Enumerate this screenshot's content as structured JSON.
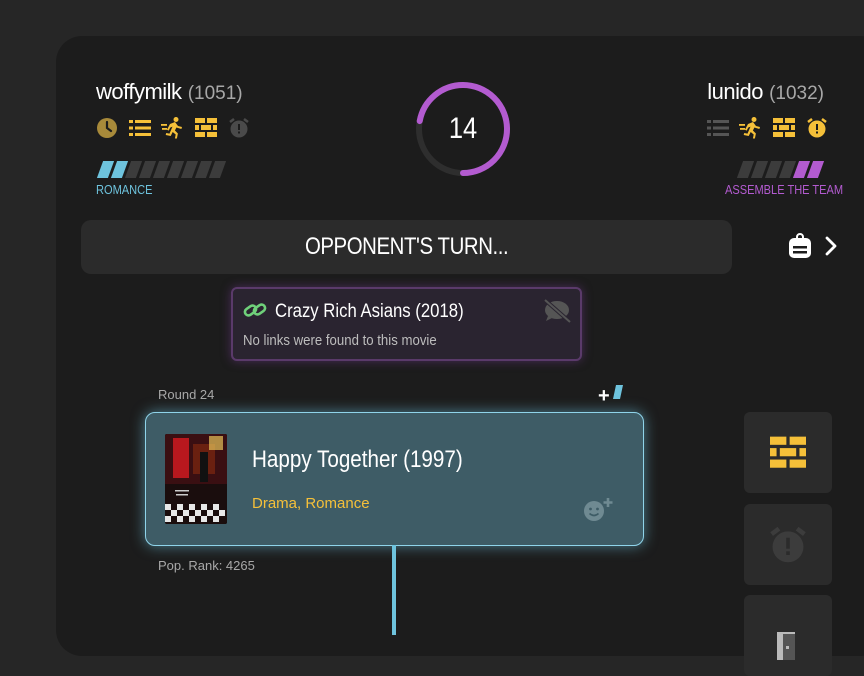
{
  "player1": {
    "name": "woffymilk",
    "rating": "(1051)",
    "genre": "ROMANCE",
    "progress_filled": 2,
    "progress_total": 9
  },
  "player2": {
    "name": "lunido",
    "rating": "(1032)",
    "genre": "ASSEMBLE THE TEAM",
    "progress_filled": 2,
    "progress_total": 6
  },
  "timer": {
    "value": "14",
    "fraction_remaining": 0.72
  },
  "turn_label": "OPPONENT'S TURN...",
  "link_box": {
    "title": "Crazy Rich Asians (2018)",
    "subtitle": "No links were found to this movie"
  },
  "round_label": "Round 24",
  "current_movie": {
    "title": "Happy Together (1997)",
    "genres": "Drama, Romance",
    "pop_rank": "Pop. Rank:  4265"
  },
  "colors": {
    "p1": "#6ec3dd",
    "p2": "#b35bd0",
    "gold": "#f5c039"
  }
}
